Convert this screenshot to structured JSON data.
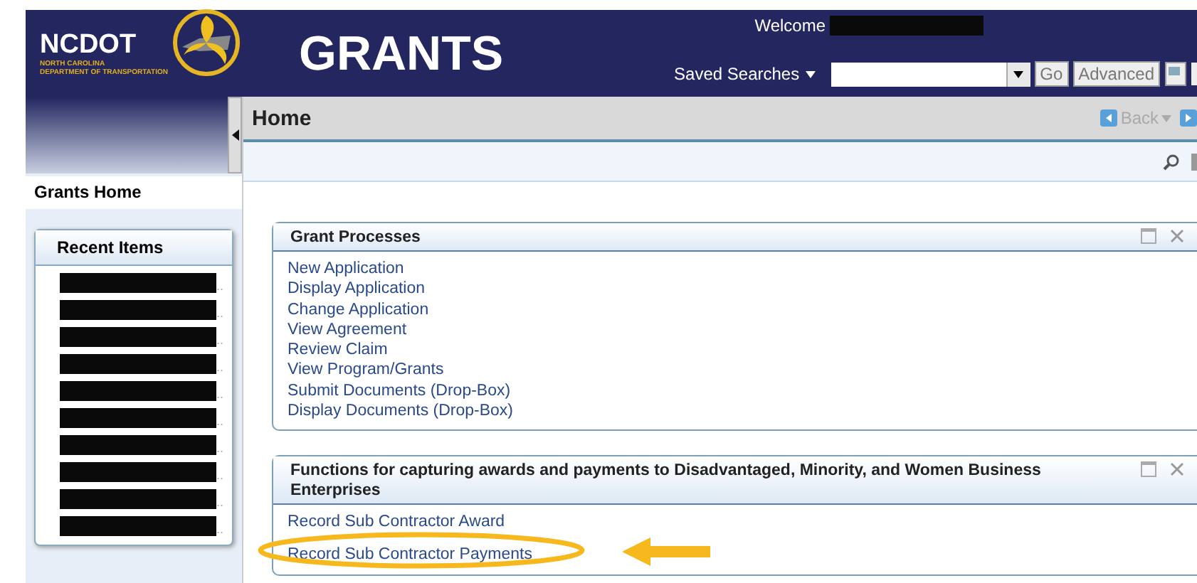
{
  "header": {
    "logo": {
      "name": "NCDOT",
      "subtitle_1": "NORTH CAROLINA",
      "subtitle_2": "DEPARTMENT OF TRANSPORTATION"
    },
    "app_title": "GRANTS",
    "welcome": {
      "label": "Welcome",
      "name_redacted": true
    },
    "saved_searches": "Saved Searches",
    "go_button": "Go",
    "advanced_button": "Advanced"
  },
  "breadcrumb": {
    "title": "Home",
    "back": "Back"
  },
  "sidebar": {
    "home": "Grants Home",
    "recent_items": {
      "title": "Recent Items",
      "items": [
        {
          "redacted": true,
          "tail": ".."
        },
        {
          "redacted": true,
          "tail": ".."
        },
        {
          "redacted": true,
          "tail": ".."
        },
        {
          "redacted": true,
          "tail": ".."
        },
        {
          "redacted": true,
          "tail": ".."
        },
        {
          "redacted": true,
          "tail": ".."
        },
        {
          "redacted": true,
          "tail": ".."
        },
        {
          "redacted": true,
          "tail": ".."
        },
        {
          "redacted": true,
          "tail": ".."
        },
        {
          "redacted": true,
          "tail": ".."
        }
      ]
    }
  },
  "panels": [
    {
      "title": "Grant Processes",
      "links": [
        {
          "text": "New Application",
          "highlighted": false
        },
        {
          "text": "Display Application",
          "highlighted": false
        },
        {
          "text": "Change Application",
          "highlighted": false
        },
        {
          "text": "View Agreement",
          "highlighted": false
        },
        {
          "text": "Review Claim",
          "highlighted": false
        },
        {
          "text": "View Program/Grants",
          "highlighted": false
        },
        {
          "text": "Submit Documents (Drop-Box)",
          "highlighted": false
        },
        {
          "text": "Display Documents (Drop-Box)",
          "highlighted": false
        }
      ]
    },
    {
      "title": "Functions for capturing awards and payments to Disadvantaged, Minority, and Women Business Enterprises",
      "links": [
        {
          "text": "Record Sub Contractor Award",
          "highlighted": false
        },
        {
          "text": "Record Sub Contractor Payments",
          "highlighted": true
        }
      ]
    }
  ]
}
